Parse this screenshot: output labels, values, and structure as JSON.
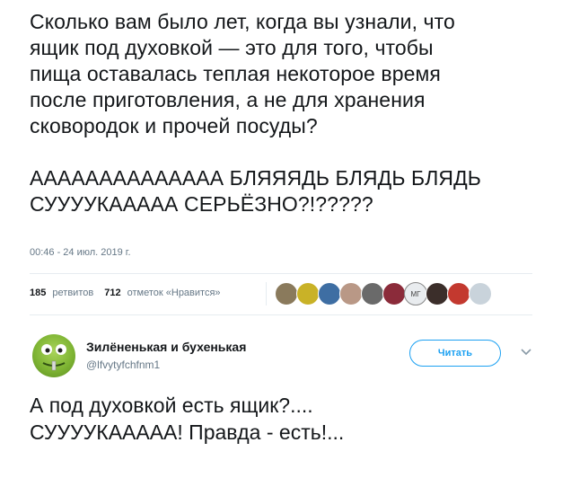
{
  "tweet": {
    "text_line_1": "Сколько вам было лет, когда вы узнали, что\nящик под духовкой — это для того, чтобы\nпища оставалась теплая некоторое время\nпосле приготовления, а не для хранения\nсковородок и прочей посуды?",
    "text_line_2": "АААААААААААААА БЛЯЯЯДЬ БЛЯДЬ БЛЯДЬ\nСУУУУКААААА СЕРЬЁЗНО?!?????",
    "timestamp": "00:46 - 24 июл. 2019 г."
  },
  "stats": {
    "retweets_count": "185",
    "retweets_label": "ретвитов",
    "likes_count": "712",
    "likes_label": "отметок «Нравится»"
  },
  "likers": [
    {
      "icon": "avatar-1",
      "color": "#8a7a5c"
    },
    {
      "icon": "avatar-2",
      "color": "#c9b227"
    },
    {
      "icon": "avatar-3",
      "color": "#3e6ea3"
    },
    {
      "icon": "avatar-4",
      "color": "#b99886"
    },
    {
      "icon": "avatar-5",
      "color": "#6a6a6a"
    },
    {
      "icon": "avatar-6",
      "color": "#8b2b3a"
    },
    {
      "icon": "avatar-7",
      "color": "#e9ecef",
      "label": "МГ"
    },
    {
      "icon": "avatar-8",
      "color": "#3b2e2a"
    },
    {
      "icon": "avatar-9",
      "color": "#c3392f"
    },
    {
      "icon": "avatar-10",
      "color": "#c9d3db"
    }
  ],
  "reply": {
    "name": "Зилёненькая и бухенькая",
    "handle": "@lfvytyfchfnm1",
    "follow_label": "Читать",
    "text": "А под духовкой есть ящик?....\nСУУУУКААААА! Правда - есть!..."
  },
  "colors": {
    "accent": "#1da1f2",
    "muted": "#657786",
    "divider": "#e6ecf0",
    "text": "#14171a"
  }
}
